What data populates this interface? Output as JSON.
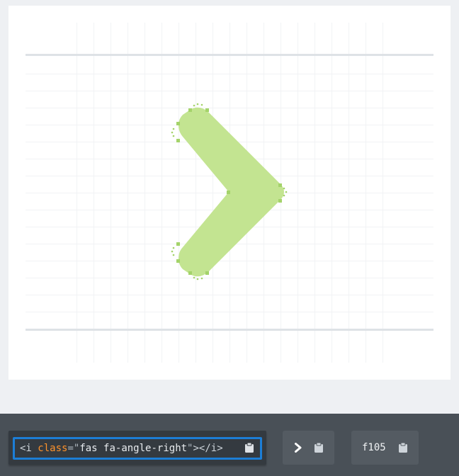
{
  "preview": {
    "icon_name": "angle-right-icon",
    "fill_color": "#c3e491",
    "handle_color": "#a4d36a",
    "grid_color": "#f1f3f5",
    "guide_color": "#dee2e6"
  },
  "snippet": {
    "open_tag": "<i ",
    "attr_name": "class",
    "equals": "=",
    "quote_open": "\"",
    "class_value": "fas fa-angle-right",
    "quote_close": "\"",
    "close_part": "></i>",
    "copy_icon": "clipboard-icon"
  },
  "glyph": {
    "icon": "angle-right-icon",
    "copy_icon": "clipboard-icon"
  },
  "unicode": {
    "value": "f105",
    "copy_icon": "clipboard-icon"
  },
  "colors": {
    "accent": "#1c7ed6",
    "bar_bg": "#495057",
    "attr": "#ff922b"
  }
}
